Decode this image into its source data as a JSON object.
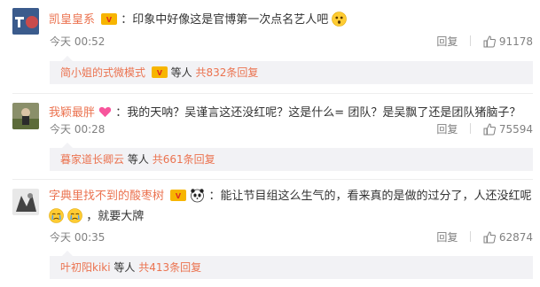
{
  "comments": [
    {
      "username": "凯皇皇系",
      "text": "：印象中好像这是官博第一次点名艺人吧",
      "time": "今天 00:52",
      "reply_label": "回复",
      "likes": "91178",
      "replies": {
        "first": "简小姐的式微模式",
        "others": "等人",
        "total": "共832条回复"
      }
    },
    {
      "username": "我颖最胖",
      "text": "：我的天呐？吴谨言这还没红呢？这是什么= 团队？是吴飘了还是团队猪脑子？",
      "time": "今天 00:28",
      "reply_label": "回复",
      "likes": "75594",
      "replies": {
        "first": "暮家道长卿云",
        "others": "等人",
        "total": "共661条回复"
      }
    },
    {
      "username": "字典里找不到的酸枣树",
      "text": "：能让节目组这么生气的，看来真的是做的过分了，人还没红呢",
      "text2": "，就要大牌",
      "time": "今天 00:35",
      "reply_label": "回复",
      "likes": "62874",
      "replies": {
        "first": "叶初阳kiki",
        "others": "等人",
        "total": "共413条回复"
      }
    }
  ],
  "colors": {
    "accent": "#eb7350",
    "meta": "#808080",
    "reply_bg": "#f2f2f5"
  }
}
